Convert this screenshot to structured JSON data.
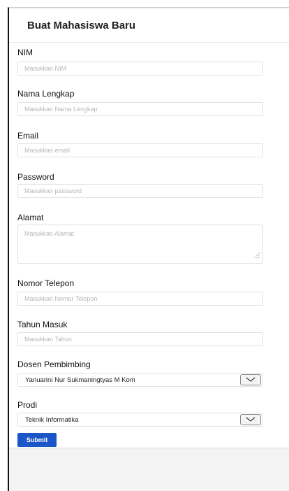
{
  "form": {
    "title": "Buat Mahasiswa Baru",
    "fields": {
      "nim": {
        "label": "NIM",
        "placeholder": "Masukkan NIM"
      },
      "nama": {
        "label": "Nama Lengkap",
        "placeholder": "Masukkan Nama Lengkap"
      },
      "email": {
        "label": "Email",
        "placeholder": "Masukkan email"
      },
      "password": {
        "label": "Password",
        "placeholder": "Masukkan password"
      },
      "alamat": {
        "label": "Alamat",
        "placeholder": "Masukkan Alamat"
      },
      "telepon": {
        "label": "Nomor Telepon",
        "placeholder": "Masukkan Nomor Telepon"
      },
      "tahun": {
        "label": "Tahun Masuk",
        "placeholder": "Masukkan Tahun"
      },
      "dosen": {
        "label": "Dosen Pembimbing",
        "selected": "Yanuarini Nur Sukmaningtyas M Kom"
      },
      "prodi": {
        "label": "Prodi",
        "selected": "Teknik Informatika"
      }
    },
    "submit_label": "Submit"
  },
  "icons": {
    "select_arrow": "chevron-down-icon",
    "resize": "resize-grip-icon"
  },
  "colors": {
    "accent": "#1a56c8",
    "border": "#e2e2e2",
    "background": "#f3f3f3"
  }
}
